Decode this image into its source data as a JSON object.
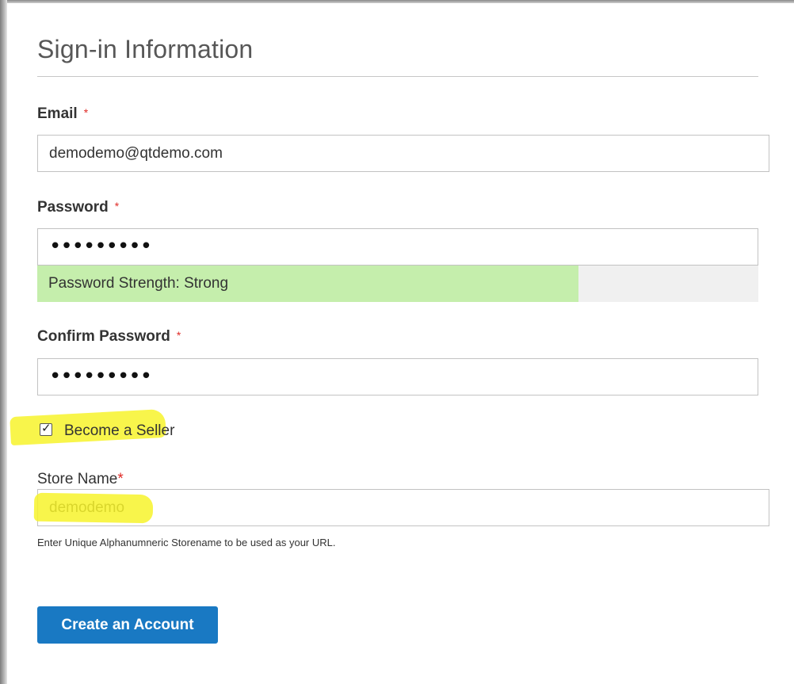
{
  "form": {
    "legend": "Sign-in Information",
    "required_marker": "*",
    "email": {
      "label": "Email",
      "value": "demodemo@qtdemo.com"
    },
    "password": {
      "label": "Password",
      "masked_value": "•••••••••"
    },
    "password_strength": {
      "text": "Password Strength: Strong",
      "level": 0.75
    },
    "confirm_password": {
      "label": "Confirm Password",
      "masked_value": "•••••••••"
    },
    "become_seller": {
      "label": "Become a Seller",
      "checked": true
    },
    "store_name": {
      "label": "Store Name",
      "value": "demodemo",
      "note": "Enter Unique Alphanumneric Storename to be used as your URL."
    },
    "submit_label": "Create an Account"
  },
  "colors": {
    "accent": "#1979c3",
    "required": "#e02b27",
    "strength_strong": "#c5eeac",
    "highlight": "#f7f32c"
  }
}
